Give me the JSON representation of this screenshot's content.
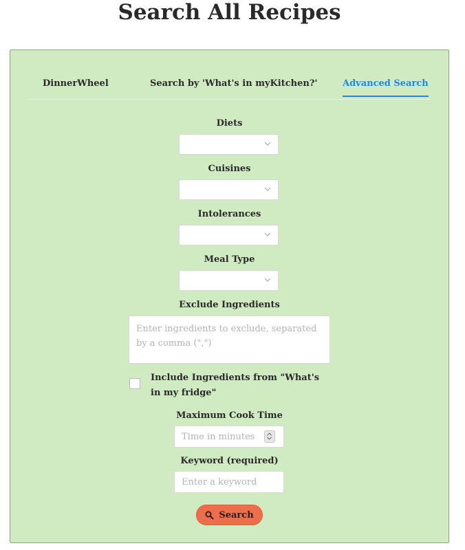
{
  "page": {
    "title": "Search All Recipes"
  },
  "tabs": [
    {
      "label": "DinnerWheel",
      "active": false
    },
    {
      "label": "Search by 'What's in myKitchen?'",
      "active": false
    },
    {
      "label": "Advanced Search",
      "active": true
    }
  ],
  "form": {
    "diets": {
      "label": "Diets",
      "value": ""
    },
    "cuisines": {
      "label": "Cuisines",
      "value": ""
    },
    "intolerances": {
      "label": "Intolerances",
      "value": ""
    },
    "meal_type": {
      "label": "Meal Type",
      "value": ""
    },
    "exclude": {
      "label": "Exclude Ingredients",
      "placeholder": "Enter ingredients to exclude, separated by a comma (\",\")",
      "value": ""
    },
    "include_fridge": {
      "label": "Include Ingredients from \"What's in my fridge\"",
      "checked": false
    },
    "max_cook_time": {
      "label": "Maximum Cook Time",
      "placeholder": "Time in minutes",
      "value": ""
    },
    "keyword": {
      "label": "Keyword (required)",
      "placeholder": "Enter a keyword",
      "value": ""
    }
  },
  "search_button": {
    "label": "Search"
  },
  "colors": {
    "panel_bg": "#d0eac2",
    "active_tab": "#1e88e5",
    "button": "#ee6d4b"
  },
  "icons": {
    "select": "chevron-down-icon",
    "button": "search-icon",
    "spinner": "chevron-up-down-icon"
  }
}
